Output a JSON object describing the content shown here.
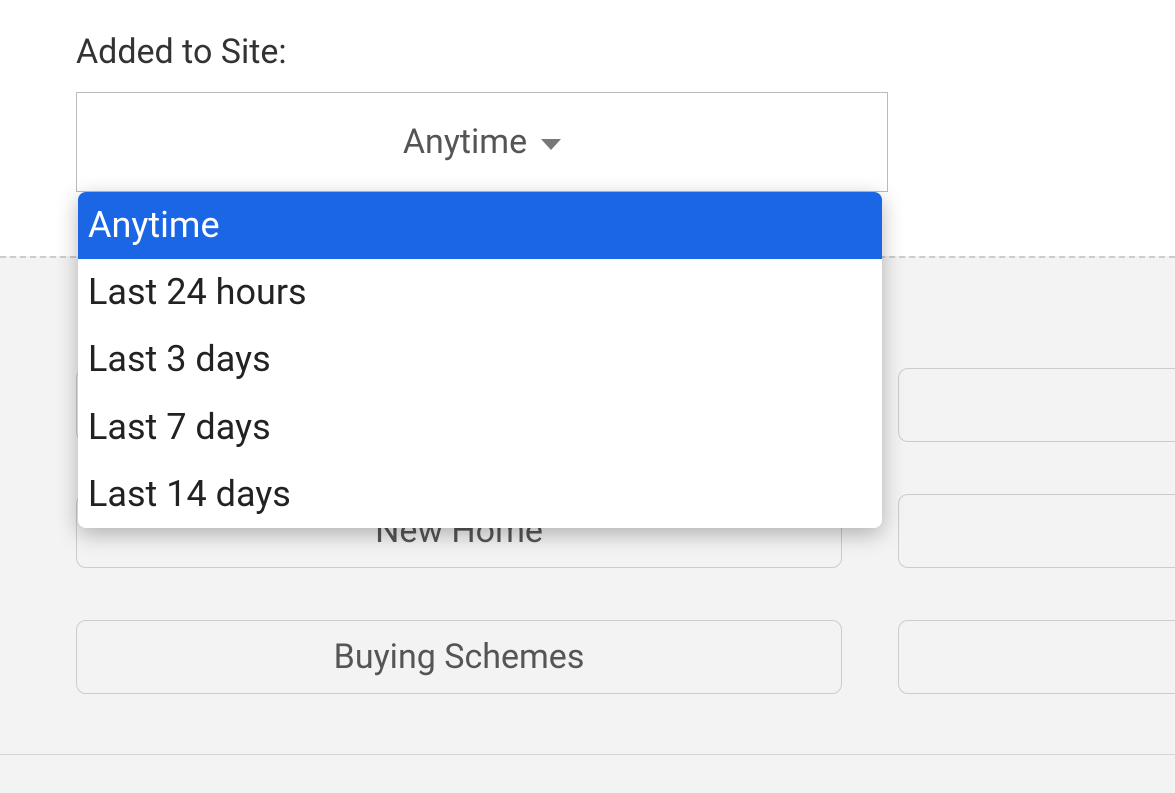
{
  "added_to_site": {
    "label": "Added to Site:",
    "selected": "Anytime",
    "options": [
      "Anytime",
      "Last 24 hours",
      "Last 3 days",
      "Last 7 days",
      "Last 14 days"
    ]
  },
  "filters": {
    "row1_left": "",
    "row1_right": "",
    "row2_left": "New Home",
    "row2_right": "",
    "row3_left": "Buying Schemes",
    "row3_right": ""
  }
}
